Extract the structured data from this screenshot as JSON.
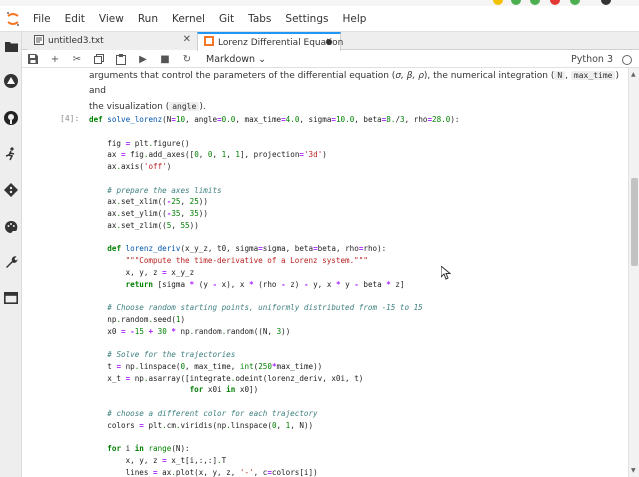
{
  "menu": [
    "File",
    "Edit",
    "View",
    "Run",
    "Kernel",
    "Git",
    "Tabs",
    "Settings",
    "Help"
  ],
  "tabs": [
    {
      "label": "untitled3.txt",
      "close": "✕"
    },
    {
      "label": "Lorenz Differential Equation"
    }
  ],
  "toolbar": {
    "save": "💾",
    "add": "+",
    "cut": "✂",
    "copy": "⎘",
    "paste": "📋",
    "run": "▶",
    "stop": "■",
    "restart": "↻",
    "cell_type": "Markdown",
    "kernel": "Python 3"
  },
  "markdown": {
    "line1_a": "arguments that control the parameters of the differential equation (",
    "line1_b": "σ, β, ρ",
    "line1_c": "), the numerical integration (",
    "line1_d": "N",
    "line1_e": ",",
    "line1_f": "max_time",
    "line1_g": ") and",
    "line2_a": "the visualization (",
    "line2_b": "angle",
    "line2_c": ")."
  },
  "cell": {
    "prompt": "[4]:",
    "lines": [
      "def solve_lorenz(N=10, angle=0.0, max_time=4.0, sigma=10.0, beta=8./3, rho=28.0):",
      "",
      "    fig = plt.figure()",
      "    ax = fig.add_axes([0, 0, 1, 1], projection='3d')",
      "    ax.axis('off')",
      "",
      "    # prepare the axes limits",
      "    ax.set_xlim((-25, 25))",
      "    ax.set_ylim((-35, 35))",
      "    ax.set_zlim((5, 55))",
      "",
      "    def lorenz_deriv(x_y_z, t0, sigma=sigma, beta=beta, rho=rho):",
      "        \"\"\"Compute the time-derivative of a Lorenz system.\"\"\"",
      "        x, y, z = x_y_z",
      "        return [sigma * (y - x), x * (rho - z) - y, x * y - beta * z]",
      "",
      "    # Choose random starting points, uniformly distributed from -15 to 15",
      "    np.random.seed(1)",
      "    x0 = -15 + 30 * np.random.random((N, 3))",
      "",
      "    # Solve for the trajectories",
      "    t = np.linspace(0, max_time, int(250*max_time))",
      "    x_t = np.asarray([integrate.odeint(lorenz_deriv, x0i, t)",
      "                      for x0i in x0])",
      "",
      "    # choose a different color for each trajectory",
      "    colors = plt.cm.viridis(np.linspace(0, 1, N))",
      "",
      "    for i in range(N):",
      "        x, y, z = x_t[i,:,:].T",
      "        lines = ax.plot(x, y, z, '-', c=colors[i])"
    ]
  },
  "colors": {
    "accent": "#2196f3",
    "jupyter_orange": "#f37626",
    "keyword": "#008000",
    "string": "#ba2121",
    "comment": "#408080"
  }
}
